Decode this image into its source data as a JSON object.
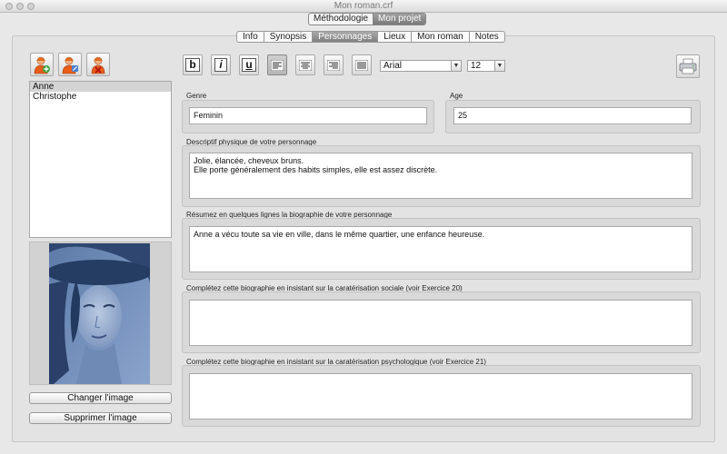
{
  "window": {
    "title": "Mon roman.crf"
  },
  "top_tabs": [
    {
      "label": "Méthodologie",
      "selected": false
    },
    {
      "label": "Mon projet",
      "selected": true
    }
  ],
  "sub_tabs": [
    {
      "label": "Info",
      "selected": false
    },
    {
      "label": "Synopsis",
      "selected": false
    },
    {
      "label": "Personnages",
      "selected": true
    },
    {
      "label": "Lieux",
      "selected": false
    },
    {
      "label": "Mon roman",
      "selected": false
    },
    {
      "label": "Notes",
      "selected": false
    }
  ],
  "toolbar": {
    "bold": "b",
    "italic": "i",
    "underline": "u",
    "font_family": "Arial",
    "font_size": "12"
  },
  "characters": [
    "Anne",
    "Christophe"
  ],
  "selected_character": "Anne",
  "image_buttons": {
    "change": "Changer l'image",
    "remove": "Supprimer l'image"
  },
  "fields": {
    "genre_label": "Genre",
    "genre_value": "Feminin",
    "age_label": "Age",
    "age_value": "25",
    "physique_label": "Descriptif physique de votre personnage",
    "physique_value": "Jolie, élancée, cheveux bruns.\nElle porte généralement des habits simples, elle est assez discrète.",
    "bio_label": "Résumez en quelques lignes la biographie de votre personnage",
    "bio_value": "Anne a vécu toute sa vie en ville, dans le même quartier, une enfance heureuse.",
    "social_label": "Complétez cette biographie en insistant sur la caratérisation sociale (voir Exercice 20)",
    "social_value": "",
    "psych_label": "Complétez cette biographie en insistant sur la caratérisation psychologique (voir Exercice 21)",
    "psych_value": ""
  },
  "icons": {
    "add_character": "add-person-icon",
    "edit_character": "edit-person-icon",
    "remove_character": "remove-person-icon",
    "print": "printer-icon"
  }
}
